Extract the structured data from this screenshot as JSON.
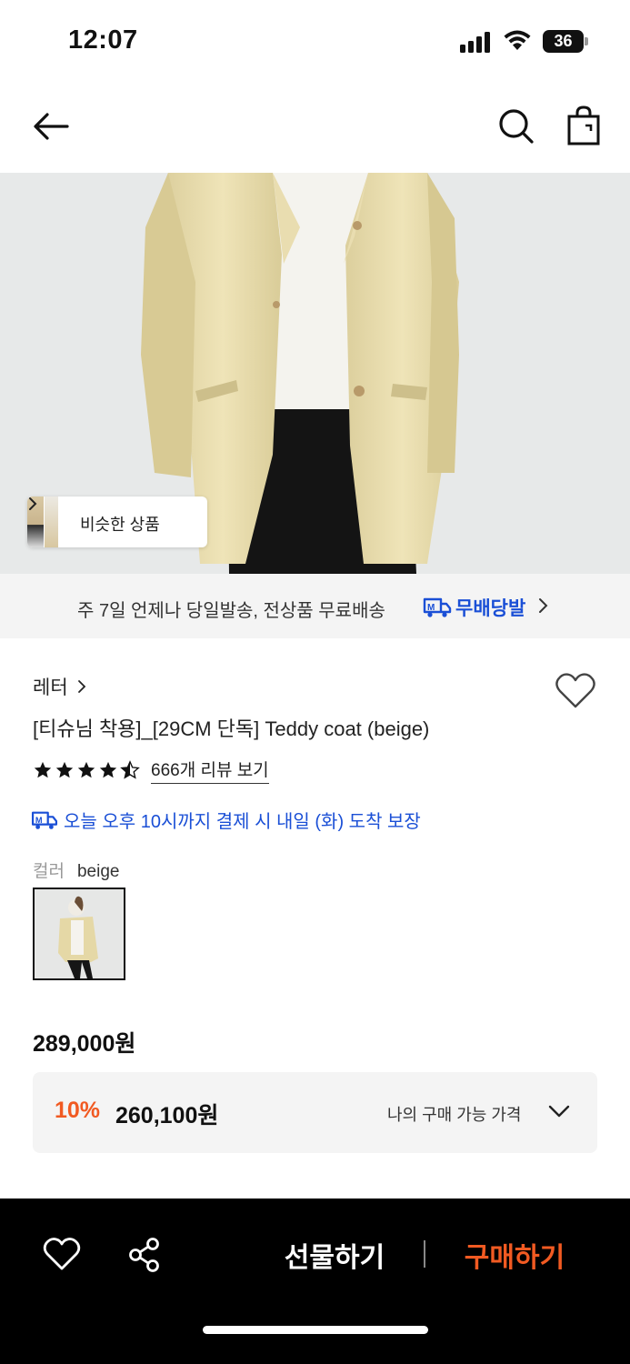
{
  "status_bar": {
    "time": "12:07",
    "battery": "36",
    "icons": [
      "signal-icon",
      "wifi-icon",
      "battery-icon"
    ]
  },
  "nav": {
    "icons": [
      "back-arrow-icon",
      "search-icon",
      "shopping-bag-icon"
    ]
  },
  "hero": {
    "similar_products_label": "비슷한 상품"
  },
  "delivery_banner": {
    "text": "주 7일 언제나 당일발송, 전상품 무료배송",
    "badge_label": "무배당발"
  },
  "product": {
    "brand": "레터",
    "title": "[티슈님 착용]_[29CM 단독] Teddy coat (beige)",
    "rating": 4.5,
    "review_link": "666개 리뷰 보기",
    "arrival_text": "오늘 오후 10시까지 결제 시 내일 (화) 도착 보장",
    "color_label": "컬러",
    "color_value": "beige"
  },
  "price": {
    "original": "289,000원",
    "discount_rate": "10%",
    "discount_price": "260,100원",
    "my_price_label": "나의 구매 가능 가격"
  },
  "bottom_bar": {
    "gift_label": "선물하기",
    "buy_label": "구매하기"
  },
  "colors": {
    "accent_orange": "#f15a22",
    "delivery_blue": "#1a4fd6",
    "coat_beige": "#e8dcae"
  }
}
